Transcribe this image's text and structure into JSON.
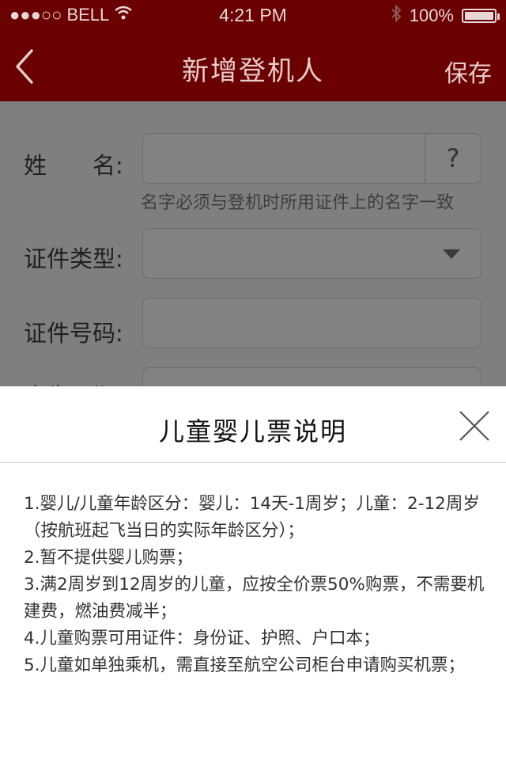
{
  "status_bar": {
    "signal": "●●●○○",
    "carrier": "BELL",
    "time": "4:21 PM",
    "battery": "100%",
    "battery_level": 1.0
  },
  "nav": {
    "title": "新增登机人",
    "save_label": "保存",
    "back_icon": "chevron-left-icon"
  },
  "form": {
    "name_label": "姓　　名:",
    "name_help": "?",
    "name_hint": "名字必须与登机时所用证件上的名字一致",
    "id_type_label": "证件类型:",
    "id_number_label": "证件号码:",
    "birth_label": "出生日期:"
  },
  "modal": {
    "title": "儿童婴儿票说明",
    "close_icon": "close-icon",
    "items": [
      "1.婴儿/儿童年龄区分：婴儿：14天-1周岁；儿童：2-12周岁（按航班起飞当日的实际年龄区分）；",
      "2.暂不提供婴儿购票；",
      "3.满2周岁到12周岁的儿童，应按全价票50%购票，不需要机建费，燃油费减半；",
      "4.儿童购票可用证件：身份证、护照、户口本；",
      "5.儿童如单独乘机，需直接至航空公司柜台申请购买机票；"
    ]
  },
  "colors": {
    "brand": "#6b0000",
    "overlay": "#7f7f7f",
    "sheet": "#ffffff"
  }
}
